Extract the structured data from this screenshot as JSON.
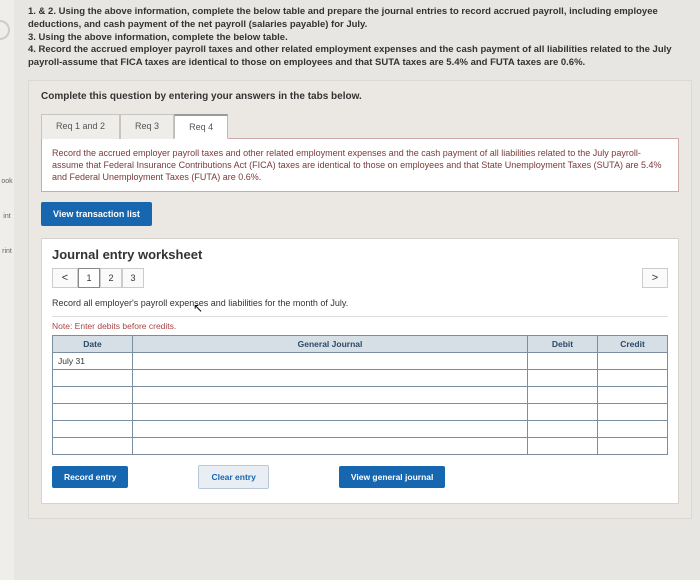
{
  "leftbar": [
    "ook",
    "int",
    "rint"
  ],
  "question": {
    "l1": "1. & 2. Using the above information, complete the below table and prepare the journal entries to record accrued payroll, including employee deductions, and cash payment of the net payroll (salaries payable) for July.",
    "l2": "3. Using the above information, complete the below table.",
    "l3": "4. Record the accrued employer payroll taxes and other related employment expenses and the cash payment of all liabilities related to the July payroll-assume that FICA taxes are identical to those on employees and that SUTA taxes are 5.4% and FUTA taxes are 0.6%."
  },
  "panel_lead": "Complete this question by entering your answers in the tabs below.",
  "tabs": {
    "t1": "Req 1 and 2",
    "t2": "Req 3",
    "t3": "Req 4"
  },
  "instr": "Record the accrued employer payroll taxes and other related employment expenses and the cash payment of all liabilities related to the July payroll-assume that Federal Insurance Contributions Act (FICA) taxes are identical to those on employees and that State Unemployment Taxes (SUTA) are 5.4% and Federal Unemployment Taxes (FUTA) are 0.6%.",
  "vtl": "View transaction list",
  "ws_title": "Journal entry worksheet",
  "pager": {
    "prev": "<",
    "p1": "1",
    "p2": "2",
    "p3": "3",
    "next": ">"
  },
  "sub": "Record all employer's payroll expenses and liabilities for the month of July.",
  "note": "Note: Enter debits before credits.",
  "table": {
    "date": "Date",
    "gj": "General Journal",
    "debit": "Debit",
    "credit": "Credit",
    "row_date": "July 31"
  },
  "buttons": {
    "rec": "Record entry",
    "clr": "Clear entry",
    "vgj": "View general journal"
  }
}
